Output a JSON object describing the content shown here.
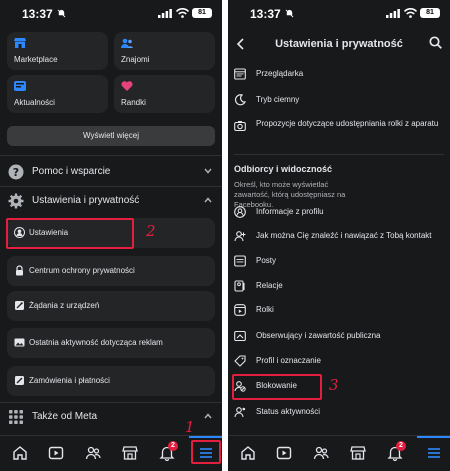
{
  "status": {
    "time": "13:37",
    "battery": "81"
  },
  "left": {
    "shortcuts": [
      {
        "label": "Marketplace",
        "icon": "marketplace-icon",
        "color": "#2d88ff"
      },
      {
        "label": "Znajomi",
        "icon": "friends-icon",
        "color": "#2d88ff"
      },
      {
        "label": "Aktualności",
        "icon": "feed-icon",
        "color": "#2d88ff"
      },
      {
        "label": "Randki",
        "icon": "dating-icon",
        "color": "#e4447b"
      }
    ],
    "see_more": "Wyświetl więcej",
    "help": "Pomoc i wsparcie",
    "settings_privacy": "Ustawienia i prywatność",
    "sub_items": [
      "Ustawienia",
      "Centrum ochrony prywatności",
      "Żądania z urządzeń",
      "Ostatnia aktywność dotycząca reklam",
      "Zamówienia i płatności"
    ],
    "also_meta": "Także od Meta",
    "marks": {
      "one": "1",
      "two": "2"
    }
  },
  "right": {
    "title": "Ustawienia i prywatność",
    "top_rows": [
      "Przeglądarka",
      "Tryb ciemny",
      "Propozycje dotyczące udostępniania rolki z aparatu"
    ],
    "section_title": "Odbiorcy i widoczność",
    "section_desc": "Określ, kto może wyświetlać zawartość, którą udostępniasz na Facebooku.",
    "rows": [
      "Informacje z profilu",
      "Jak można Cię znaleźć i nawiązać z Tobą kontakt",
      "Posty",
      "Relacje",
      "Rolki",
      "Obserwujący i zawartość publiczna",
      "Profil i oznaczanie",
      "Blokowanie",
      "Status aktywności"
    ],
    "mark_three": "3"
  },
  "nav": {
    "notif_badge": "2"
  },
  "colors": {
    "accent": "#2d88ff",
    "annotation": "#e41e3f",
    "background": "#18191a"
  }
}
